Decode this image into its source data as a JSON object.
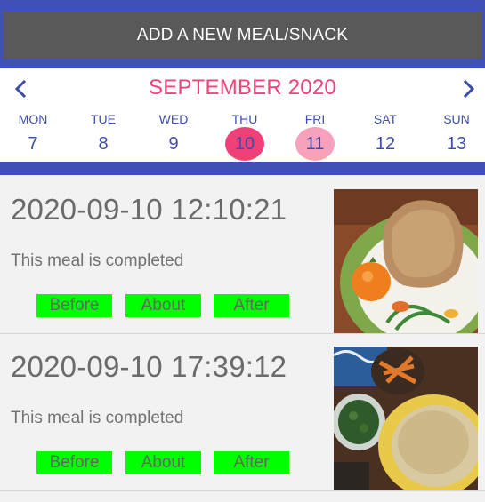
{
  "header": {
    "add_label": "ADD A NEW MEAL/SNACK"
  },
  "calendar": {
    "month": "SEPTEMBER 2020",
    "days": [
      {
        "dow": "MON",
        "num": "7"
      },
      {
        "dow": "TUE",
        "num": "8"
      },
      {
        "dow": "WED",
        "num": "9"
      },
      {
        "dow": "THU",
        "num": "10"
      },
      {
        "dow": "FRI",
        "num": "11"
      },
      {
        "dow": "SAT",
        "num": "12"
      },
      {
        "dow": "SUN",
        "num": "13"
      }
    ],
    "colors": {
      "accent": "#f1437a",
      "selected_circle": "#f0407a",
      "today_circle": "#f7a1bd",
      "text": "#3e4ea8"
    }
  },
  "meals": [
    {
      "timestamp": "2020-09-10 12:10:21",
      "status": "This meal is completed",
      "buttons": {
        "before": "Before",
        "about": "About",
        "after": "After"
      }
    },
    {
      "timestamp": "2020-09-10 17:39:12",
      "status": "This meal is completed",
      "buttons": {
        "before": "Before",
        "about": "About",
        "after": "After"
      }
    }
  ],
  "colors": {
    "brand": "#3f51b5",
    "button_green": "#00ff00"
  },
  "icons": {
    "prev": "chevron-left-icon",
    "next": "chevron-right-icon"
  }
}
